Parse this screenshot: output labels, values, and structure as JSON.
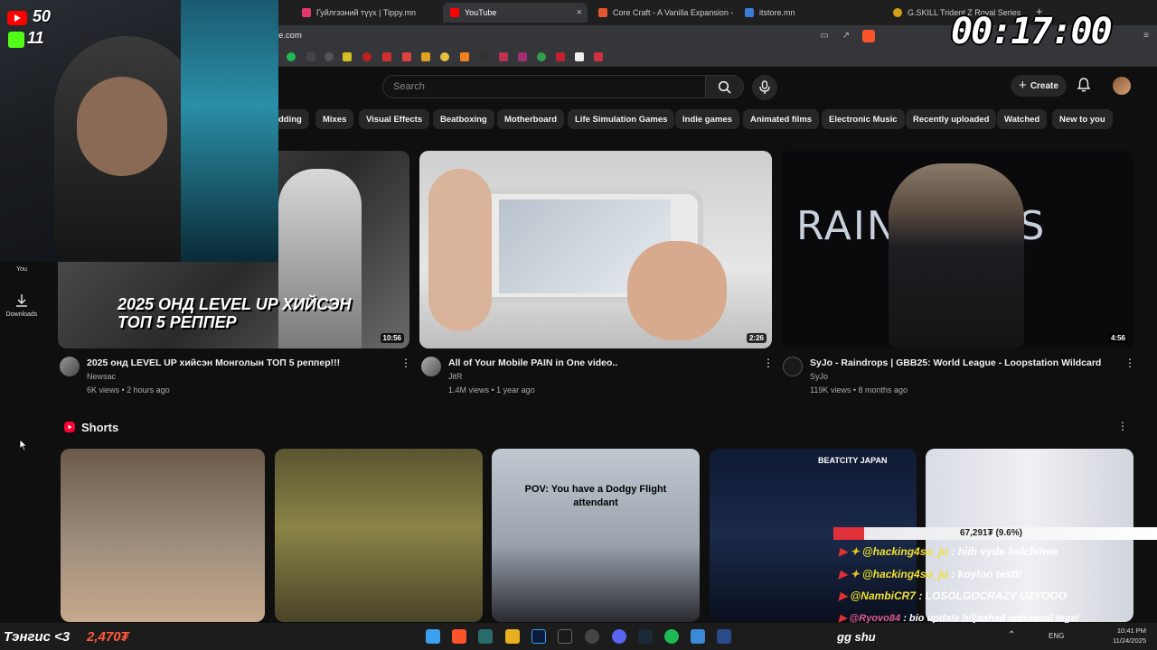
{
  "browser": {
    "tabs": [
      {
        "label": "Гуйлгээний түүх | Tippy.mn",
        "fav_color": "#e03a6a",
        "active": false
      },
      {
        "label": "YouTube",
        "fav_color": "#ff0000",
        "active": true
      },
      {
        "label": "Core Craft - A Vanilla Expansion - M",
        "fav_color": "#e4572e",
        "active": false
      },
      {
        "label": "itstore.mn",
        "fav_color": "#3a7bd5",
        "active": false
      },
      {
        "label": "G.SKILL Trident Z Royal Series DDR4",
        "fav_color": "#d4a017",
        "active": false
      }
    ],
    "close_glyph": "×",
    "url": "e.com",
    "new_tab": "+"
  },
  "overlay": {
    "timer": "00:17:00",
    "yt_subs": "50",
    "kick_subs": "11",
    "donor_line": "Тэнгис <3",
    "donor_amount": "2,470₮",
    "gg_text": "gg shu",
    "donation_total": "67,291₮ (9.6%)",
    "chat": [
      {
        "user": "@hacking4so_ju",
        "msg": ": hiih vyde helchihee"
      },
      {
        "user": "@hacking4so_ju",
        "msg": ": koyloo testl!"
      },
      {
        "user": "@NambiCR7",
        "msg": ": LOSOLGOCRAZY UZYOOO"
      },
      {
        "user": "@Ryovo84",
        "msg": ": bio update hiljaahad untraaual tegel"
      }
    ]
  },
  "yt": {
    "search_placeholder": "Search",
    "create_label": "Create",
    "chips": [
      "dding",
      "Mixes",
      "Visual Effects",
      "Beatboxing",
      "Motherboard",
      "Life Simulation Games",
      "Indie games",
      "Animated films",
      "Electronic Music",
      "Recently uploaded",
      "Watched",
      "New to you"
    ],
    "sidebar": [
      {
        "label": "You"
      },
      {
        "label": "Downloads"
      }
    ],
    "videos": [
      {
        "title": "2025 онд LEVEL UP хийсэн Монголын ТОП 5 реппер!!!",
        "channel": "Newsac",
        "meta": "6K views • 2 hours ago",
        "duration": "10:56",
        "thumb_text": "2025 ОНД LEVEL UP ХИЙСЭН ТОП 5 РЕППЕР"
      },
      {
        "title": "All of Your Mobile PAIN in One video..",
        "channel": "JitR",
        "meta": "1.4M views • 1 year ago",
        "duration": "2:26"
      },
      {
        "title": "SyJo - Raindrops | GBB25: World League - Loopstation Wildcard",
        "channel": "SyJo",
        "meta": "119K views • 8 months ago",
        "duration": "4:56",
        "thumb_text": "RAINDROPS"
      }
    ],
    "shorts_heading": "Shorts",
    "shorts": [
      {
        "caption": "",
        "bg": "#6b5a4a"
      },
      {
        "caption": "",
        "bg": "#5a5430"
      },
      {
        "caption": "POV: You have a Dodgy Flight attendant",
        "bg": "#9aa3ad"
      },
      {
        "caption": "BEATCITY JAPAN",
        "bg": "#1a2a4a"
      },
      {
        "caption": "",
        "bg": "#c8ccd4"
      }
    ]
  },
  "taskbar": {
    "lang": "ENG",
    "time": "10:41 PM",
    "date": "11/24/2025"
  }
}
